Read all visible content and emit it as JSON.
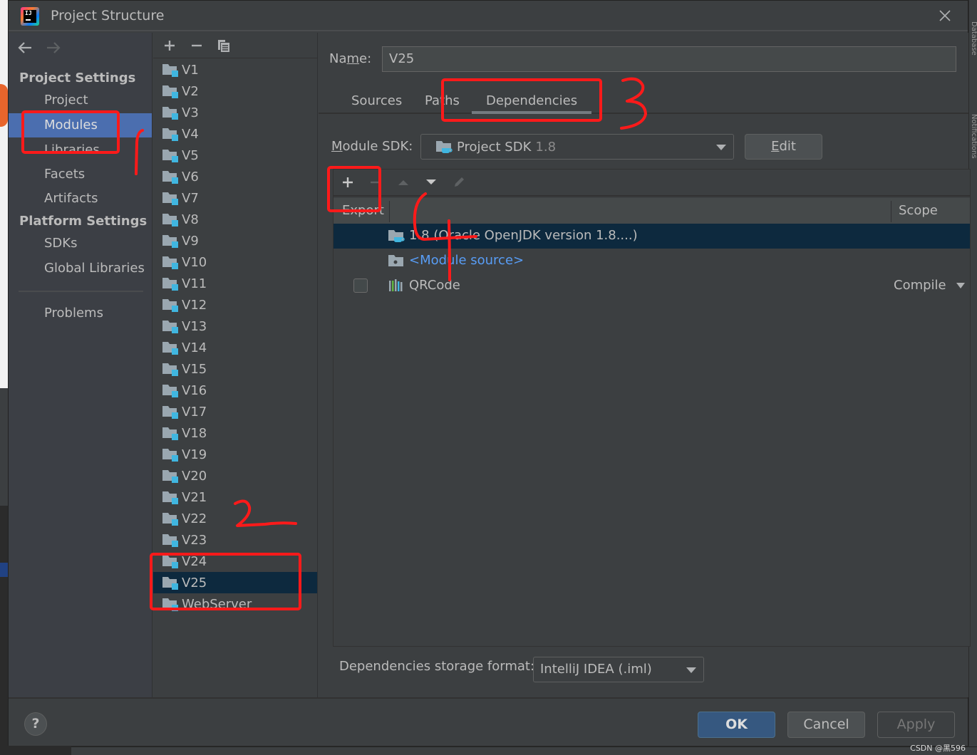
{
  "window": {
    "title": "Project Structure",
    "close_icon": "close-icon",
    "app_icon": "intellij-idea-logo-icon"
  },
  "nav": {
    "back_icon": "arrow-left-icon",
    "forward_icon": "arrow-right-icon",
    "sections": [
      {
        "title": "Project Settings",
        "items": [
          {
            "label": "Project"
          },
          {
            "label": "Modules",
            "selected": true
          },
          {
            "label": "Libraries"
          },
          {
            "label": "Facets"
          },
          {
            "label": "Artifacts"
          }
        ]
      },
      {
        "title": "Platform Settings",
        "items": [
          {
            "label": "SDKs"
          },
          {
            "label": "Global Libraries"
          }
        ]
      }
    ],
    "problems": "Problems"
  },
  "modules": {
    "toolbar": {
      "add_icon": "plus-icon",
      "remove_icon": "minus-icon",
      "copy_icon": "copy-icon"
    },
    "items": [
      "V1",
      "V2",
      "V3",
      "V4",
      "V5",
      "V6",
      "V7",
      "V8",
      "V9",
      "V10",
      "V11",
      "V12",
      "V13",
      "V14",
      "V15",
      "V16",
      "V17",
      "V18",
      "V19",
      "V20",
      "V21",
      "V22",
      "V23",
      "V24",
      "V25",
      "WebServer"
    ],
    "selected": "V25"
  },
  "module_detail": {
    "name_label": "Name:",
    "name_value": "V25",
    "tabs": [
      {
        "label": "Sources"
      },
      {
        "label": "Paths"
      },
      {
        "label": "Dependencies",
        "active": true
      }
    ],
    "sdk_label": "Module SDK:",
    "sdk_value": "Project SDK",
    "sdk_version": "1.8",
    "edit_button": "Edit",
    "deps_toolbar": {
      "add_icon": "plus-icon",
      "remove_icon": "minus-icon",
      "move_up_icon": "triangle-up-icon",
      "move_down_icon": "triangle-down-icon",
      "edit_icon": "pencil-icon"
    },
    "deps_columns": {
      "export": "Export",
      "scope": "Scope"
    },
    "dependencies": [
      {
        "name": "1.8 (Oracle OpenJDK version 1.8....)",
        "icon": "jdk-folder-icon",
        "selected": true
      },
      {
        "name": "<Module source>",
        "icon": "module-source-folder-icon",
        "link": true
      },
      {
        "name": "QRCode",
        "icon": "library-icon",
        "export": false,
        "scope": "Compile"
      }
    ],
    "storage_label": "Dependencies storage format:",
    "storage_value": "IntelliJ IDEA (.iml)"
  },
  "footer": {
    "help": "?",
    "ok": "OK",
    "cancel": "Cancel",
    "apply": "Apply"
  },
  "side_tool_windows": {
    "database": "Database",
    "notifications": "Notifications"
  },
  "annotations": {
    "step1": "1",
    "step2": "2",
    "step3": "3",
    "step4": "4",
    "color": "#ff1a1a"
  },
  "watermark": "CSDN @黑596"
}
